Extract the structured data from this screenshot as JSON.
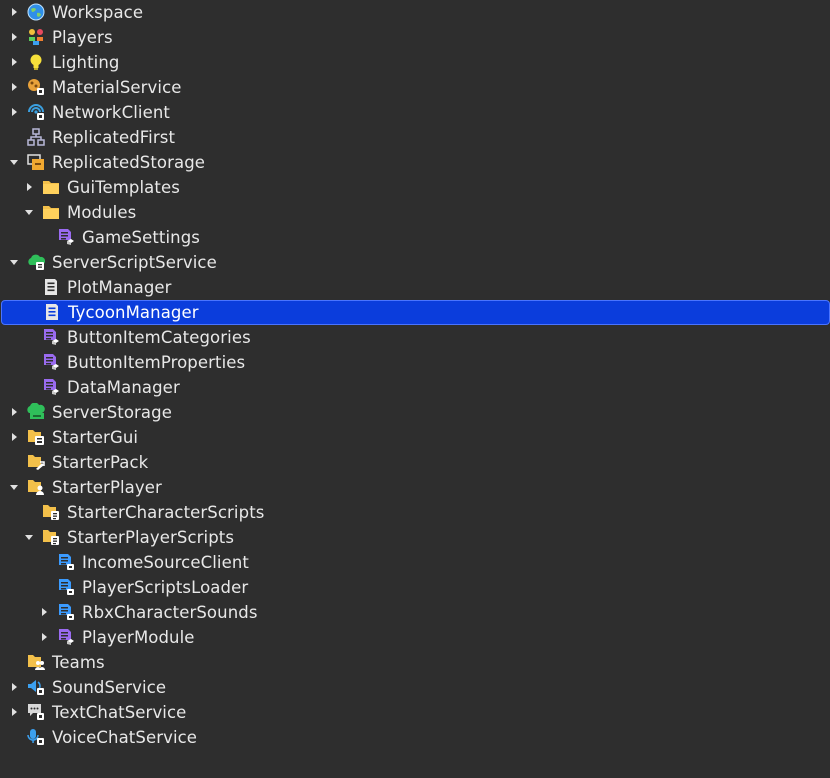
{
  "explorer": {
    "items": [
      {
        "label": "Workspace",
        "icon": "workspace-globe-icon"
      },
      {
        "label": "Players",
        "icon": "players-icon"
      },
      {
        "label": "Lighting",
        "icon": "lightbulb-icon"
      },
      {
        "label": "MaterialService",
        "icon": "material-service-icon"
      },
      {
        "label": "NetworkClient",
        "icon": "network-client-icon"
      },
      {
        "label": "ReplicatedFirst",
        "icon": "replicated-first-icon"
      },
      {
        "label": "ReplicatedStorage",
        "icon": "replicated-storage-icon"
      },
      {
        "label": "GuiTemplates",
        "icon": "folder-icon"
      },
      {
        "label": "Modules",
        "icon": "folder-icon"
      },
      {
        "label": "GameSettings",
        "icon": "module-script-icon"
      },
      {
        "label": "ServerScriptService",
        "icon": "server-script-service-icon"
      },
      {
        "label": "PlotManager",
        "icon": "script-icon"
      },
      {
        "label": "TycoonManager",
        "icon": "script-icon"
      },
      {
        "label": "ButtonItemCategories",
        "icon": "module-script-icon"
      },
      {
        "label": "ButtonItemProperties",
        "icon": "module-script-icon"
      },
      {
        "label": "DataManager",
        "icon": "module-script-icon"
      },
      {
        "label": "ServerStorage",
        "icon": "server-storage-icon"
      },
      {
        "label": "StarterGui",
        "icon": "starter-gui-icon"
      },
      {
        "label": "StarterPack",
        "icon": "starter-pack-icon"
      },
      {
        "label": "StarterPlayer",
        "icon": "starter-player-icon"
      },
      {
        "label": "StarterCharacterScripts",
        "icon": "starter-character-scripts-icon"
      },
      {
        "label": "StarterPlayerScripts",
        "icon": "starter-player-scripts-icon"
      },
      {
        "label": "IncomeSourceClient",
        "icon": "local-script-icon"
      },
      {
        "label": "PlayerScriptsLoader",
        "icon": "local-script-icon"
      },
      {
        "label": "RbxCharacterSounds",
        "icon": "local-script-icon"
      },
      {
        "label": "PlayerModule",
        "icon": "module-script-icon"
      },
      {
        "label": "Teams",
        "icon": "teams-icon"
      },
      {
        "label": "SoundService",
        "icon": "sound-service-icon"
      },
      {
        "label": "TextChatService",
        "icon": "text-chat-service-icon"
      },
      {
        "label": "VoiceChatService",
        "icon": "voice-chat-service-icon"
      }
    ]
  },
  "colors": {
    "background": "#2e2e2e",
    "selection": "#0b3ddc",
    "text": "#e8e8e8",
    "folder": "#f3c04a",
    "module_script": "#9a6bf0",
    "local_script": "#3b9bff",
    "script": "#e6e6e6"
  }
}
